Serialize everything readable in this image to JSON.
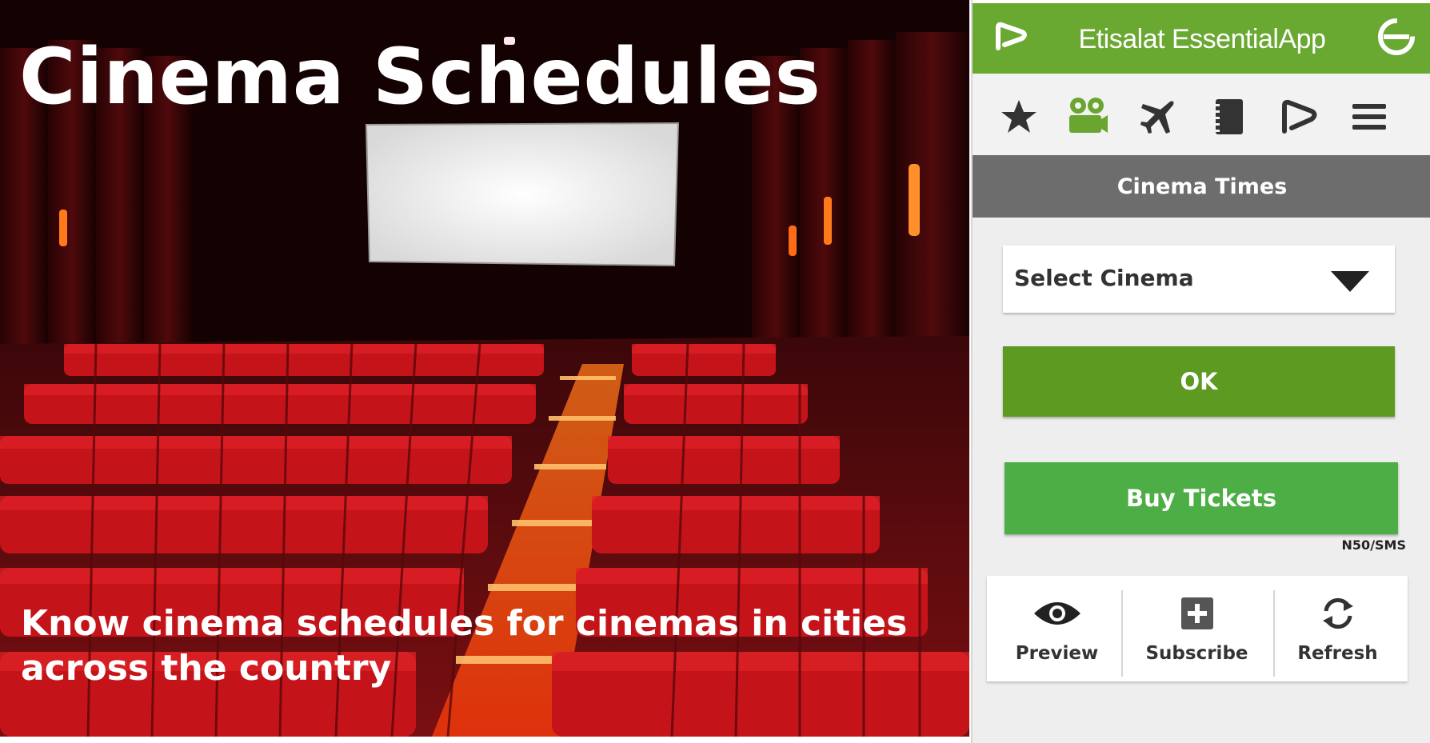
{
  "hero": {
    "title": "Cinema Schedules",
    "subtitle": "Know cinema schedules for cinemas in cities across the country"
  },
  "app": {
    "title": "Etisalat EssentialApp",
    "brand_color": "#69a831",
    "nav_icons": [
      "star-icon",
      "movie-camera-icon",
      "airplane-icon",
      "notebook-icon",
      "etisalat-logo-icon",
      "menu-icon"
    ],
    "active_nav": "movie-camera-icon",
    "section_title": "Cinema Times",
    "select": {
      "value": "Select Cinema"
    },
    "ok_label": "OK",
    "buy_label": "Buy Tickets",
    "price_note": "N50/SMS",
    "actions": [
      {
        "icon": "eye-icon",
        "label": "Preview"
      },
      {
        "icon": "plus-icon",
        "label": "Subscribe"
      },
      {
        "icon": "refresh-icon",
        "label": "Refresh"
      }
    ]
  }
}
